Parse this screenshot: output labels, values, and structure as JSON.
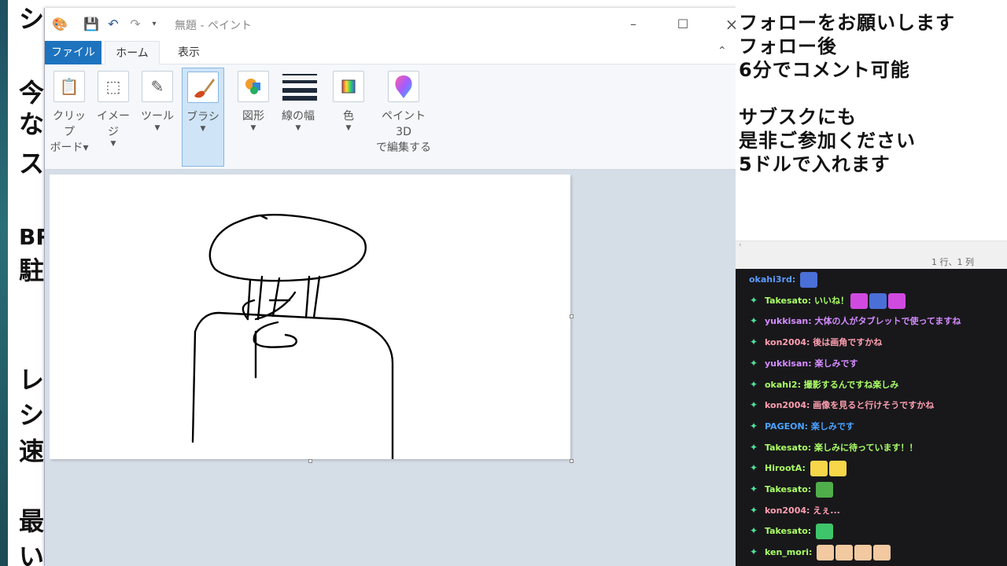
{
  "background": {
    "left_chars": [
      "シ",
      "今",
      "な",
      "ス",
      "BR",
      "駐",
      "レ",
      "シ",
      "速",
      "最",
      "い"
    ]
  },
  "window": {
    "title": "無題 - ペイント",
    "tabs": [
      "ファイル",
      "ホーム",
      "表示"
    ],
    "groups": [
      {
        "label": "クリップ\nボード▾",
        "icon": "clipboard-icon"
      },
      {
        "label": "イメージ",
        "icon": "image-select-icon"
      },
      {
        "label": "ツール",
        "icon": "tools-icon"
      },
      {
        "label": "ブラシ",
        "icon": "brush-icon"
      },
      {
        "label": "図形",
        "icon": "shapes-icon"
      },
      {
        "label": "線の幅",
        "icon": "line-width-icon"
      },
      {
        "label": "色",
        "icon": "color-palette-icon"
      },
      {
        "label": "ペイント 3D\nで編集する",
        "icon": "paint3d-icon"
      }
    ]
  },
  "overlay": {
    "lines": [
      "フォローをお願いします",
      "フォロー後",
      "6分でコメント可能",
      "",
      "サブスクにも",
      "是非ご参加ください",
      "5ドルで入れます"
    ],
    "status": "1 行、1 列"
  },
  "chat": [
    {
      "user": "okahi3rd",
      "text": "",
      "color": "#5b9bff"
    },
    {
      "user": "Takesato",
      "text": "いいね！",
      "color": "#aaff66"
    },
    {
      "user": "yukkisan",
      "text": "大体の人がタブレットで使ってますね",
      "color": "#d58cff"
    },
    {
      "user": "kon2004",
      "text": "後は画角ですかね",
      "color": "#ff9fb0"
    },
    {
      "user": "yukkisan",
      "text": "楽しみです",
      "color": "#d58cff"
    },
    {
      "user": "okahi2",
      "text": "撮影するんですね楽しみ",
      "color": "#aaff66"
    },
    {
      "user": "kon2004",
      "text": "画像を見ると行けそうですかね",
      "color": "#ff9fb0"
    },
    {
      "user": "PAGEON",
      "text": "楽しみです",
      "color": "#4aa3ff"
    },
    {
      "user": "Takesato",
      "text": "楽しみに待っています！！",
      "color": "#aaff66"
    },
    {
      "user": "HirootA",
      "text": "",
      "color": "#aaff66"
    },
    {
      "user": "Takesato",
      "text": "",
      "color": "#aaff66"
    },
    {
      "user": "kon2004",
      "text": "えぇ...",
      "color": "#ff9fb0"
    },
    {
      "user": "Takesato",
      "text": "",
      "color": "#aaff66"
    },
    {
      "user": "ken_mori",
      "text": "",
      "color": "#aaff66"
    }
  ]
}
